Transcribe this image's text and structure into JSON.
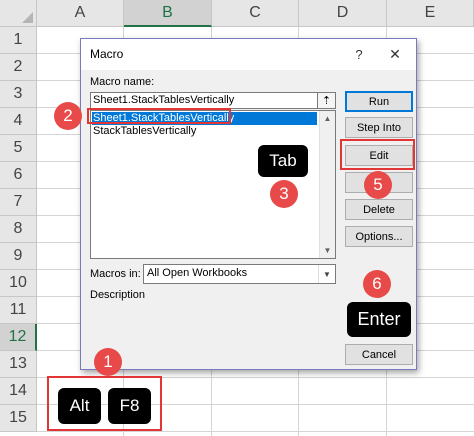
{
  "spreadsheet": {
    "columns": [
      "A",
      "B",
      "C",
      "D",
      "E"
    ],
    "selected_column": "B",
    "rows": [
      "1",
      "2",
      "3",
      "4",
      "5",
      "6",
      "7",
      "8",
      "9",
      "10",
      "11",
      "12",
      "13",
      "14",
      "15"
    ],
    "selected_row": "12"
  },
  "dialog": {
    "title": "Macro",
    "help_glyph": "?",
    "close_glyph": "✕",
    "macro_name_label": "Macro name:",
    "macro_name_value": "Sheet1.StackTablesVertically",
    "upload_glyph": "⇡",
    "list_items": [
      "Sheet1.StackTablesVertically",
      "StackTablesVertically"
    ],
    "selected_index": 0,
    "buttons": {
      "run": "Run",
      "step_into": "Step Into",
      "edit": "Edit",
      "blank": "",
      "delete": "Delete",
      "options": "Options...",
      "cancel": "Cancel"
    },
    "macros_in_label": "Macros in:",
    "macros_in_value": "All Open Workbooks",
    "description_label": "Description"
  },
  "annotations": {
    "steps": [
      "1",
      "2",
      "3",
      "5",
      "6"
    ],
    "keys": {
      "alt": "Alt",
      "f8": "F8",
      "tab": "Tab",
      "enter": "Enter"
    },
    "badge_color": "#e84a4a",
    "highlight_color": "#e23636"
  },
  "colors": {
    "selection_blue": "#0078d7",
    "excel_green": "#217346"
  },
  "icons": {
    "help": "question-icon",
    "close": "close-icon",
    "upload": "collapse-dialog-icon",
    "scroll_up": "chevron-up-icon",
    "scroll_down": "chevron-down-icon",
    "dropdown": "chevron-down-icon"
  }
}
